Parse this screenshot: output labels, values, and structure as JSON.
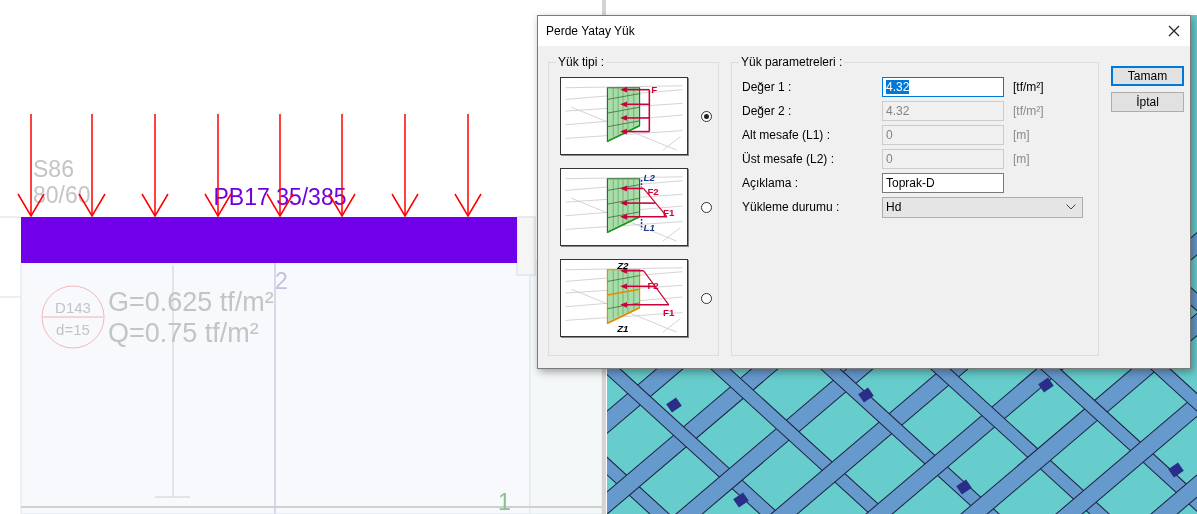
{
  "drawing": {
    "column_label": [
      "S86",
      "80/60"
    ],
    "beam_label": "PB17 35/385",
    "slab_id": "D143",
    "slab_thickness": "d=15",
    "slab_loads": [
      "G=0.625 tf/m²",
      "Q=0.75 tf/m²"
    ],
    "axis_labels": [
      "2",
      "1"
    ]
  },
  "dialog": {
    "title": "Perde Yatay Yük",
    "load_type": {
      "legend": "Yük tipi :",
      "options": [
        {
          "kind": "uniform",
          "labels": [
            "F"
          ],
          "selected": true
        },
        {
          "kind": "trapezoid",
          "labels": [
            "L2",
            "F2",
            "F1",
            "L1"
          ],
          "selected": false
        },
        {
          "kind": "story",
          "labels": [
            "Z2",
            "F2",
            "F1",
            "Z1"
          ],
          "selected": false
        }
      ]
    },
    "parameters": {
      "legend": "Yük parametreleri :",
      "fields": [
        {
          "label": "Değer 1 :",
          "value": "4.32",
          "unit": "[tf/m²]",
          "disabled": false,
          "focused": true
        },
        {
          "label": "Değer 2 :",
          "value": "4.32",
          "unit": "[tf/m²]",
          "disabled": true,
          "focused": false
        },
        {
          "label": "Alt mesafe (L1) :",
          "value": "0",
          "unit": "[m]",
          "disabled": true,
          "focused": false
        },
        {
          "label": "Üst mesafe (L2) :",
          "value": "0",
          "unit": "[m]",
          "disabled": true,
          "focused": false
        },
        {
          "label": "Açıklama :",
          "value": "Toprak-D",
          "disabled": false,
          "focused": false
        }
      ],
      "loading_case": {
        "label": "Yükleme durumu :",
        "value": "Hd"
      }
    },
    "buttons": [
      {
        "label": "Tamam",
        "default": true
      },
      {
        "label": "İptal",
        "default": false
      }
    ]
  }
}
